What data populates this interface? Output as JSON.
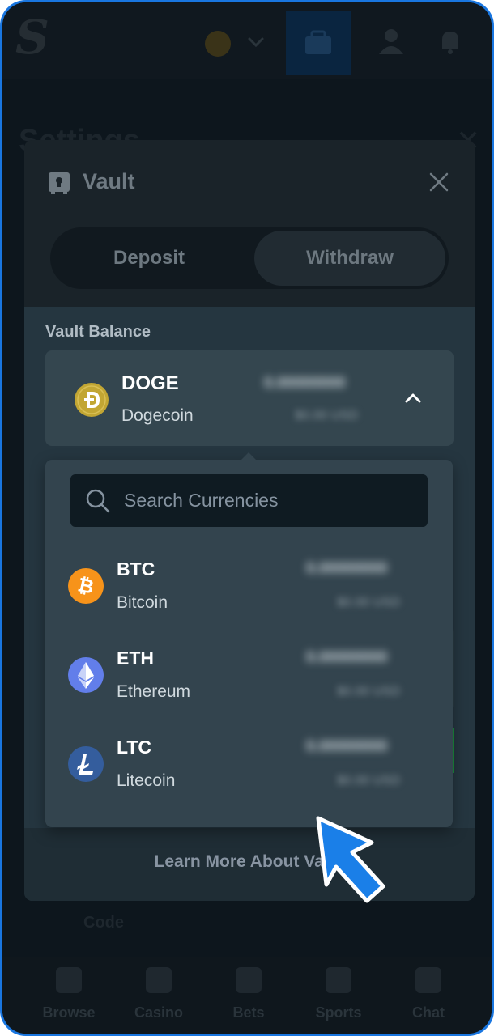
{
  "app": {
    "logo_letter": "S"
  },
  "header": {
    "settings_title": "Settings"
  },
  "background": {
    "code_label": "Code"
  },
  "bottom_nav": [
    {
      "label": "Browse"
    },
    {
      "label": "Casino"
    },
    {
      "label": "Bets"
    },
    {
      "label": "Sports"
    },
    {
      "label": "Chat"
    }
  ],
  "vault": {
    "title": "Vault",
    "tabs": {
      "deposit": "Deposit",
      "withdraw": "Withdraw",
      "active": "withdraw"
    },
    "balance_label": "Vault Balance",
    "learn_more": "Learn More About Vault",
    "selected": {
      "code": "DOGE",
      "name": "Dogecoin",
      "amount": "0.00000000",
      "usd": "$0.00 USD",
      "color": "#c2a633"
    }
  },
  "dropdown": {
    "search_placeholder": "Search Currencies",
    "search_value": "",
    "currencies": [
      {
        "code": "BTC",
        "name": "Bitcoin",
        "amount": "0.00000000",
        "usd": "$0.00 USD",
        "color": "#f7931a",
        "icon": "bitcoin-icon"
      },
      {
        "code": "ETH",
        "name": "Ethereum",
        "amount": "0.00000000",
        "usd": "$0.00 USD",
        "color": "#627eea",
        "icon": "ethereum-icon"
      },
      {
        "code": "LTC",
        "name": "Litecoin",
        "amount": "0.00000000",
        "usd": "$0.00 USD",
        "color": "#345d9d",
        "icon": "litecoin-icon"
      }
    ]
  },
  "colors": {
    "accent_blue": "#1976e0",
    "panel": "#253640",
    "dropdown": "#33444e",
    "search_bg": "#0f1b22"
  }
}
